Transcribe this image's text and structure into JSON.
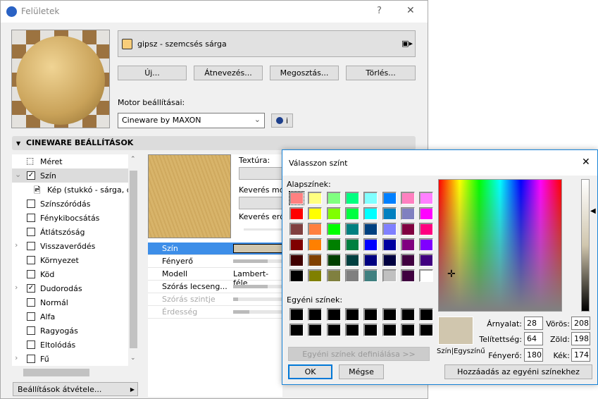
{
  "window": {
    "title": "Felületek",
    "help": "?",
    "close": "✕"
  },
  "material": {
    "name": "gipsz - szemcsés sárga",
    "swatch": "#f8cd7a"
  },
  "buttons": {
    "new": "Új...",
    "rename": "Átnevezés...",
    "share": "Megosztás...",
    "delete": "Törlés..."
  },
  "engine": {
    "label": "Motor beállításai:",
    "value": "Cineware by MAXON",
    "info": "i"
  },
  "section": {
    "title": "CINEWARE BEÁLLÍTÁSOK"
  },
  "tree": [
    {
      "label": "Méret",
      "type": "icon"
    },
    {
      "label": "Szín",
      "checked": true,
      "expandable": true,
      "expanded": true,
      "selected": true
    },
    {
      "label": "Kép (stukkó - sárga, du",
      "type": "image"
    },
    {
      "label": "Színszóródás",
      "checked": false
    },
    {
      "label": "Fénykibocsátás",
      "checked": false
    },
    {
      "label": "Átlátszóság",
      "checked": false
    },
    {
      "label": "Visszaverődés",
      "checked": false,
      "expandable": true
    },
    {
      "label": "Környezet",
      "checked": false
    },
    {
      "label": "Köd",
      "checked": false
    },
    {
      "label": "Dudorodás",
      "checked": true,
      "expandable": true
    },
    {
      "label": "Normál",
      "checked": false
    },
    {
      "label": "Alfa",
      "checked": false
    },
    {
      "label": "Ragyogás",
      "checked": false
    },
    {
      "label": "Eltolódás",
      "checked": false
    },
    {
      "label": "Fű",
      "checked": false,
      "expandable": true
    }
  ],
  "take_settings": "Beállítások átvétele...",
  "texture": {
    "label": "Textúra:",
    "blend_mode": "Keverés mód",
    "blend_strength": "Keverés erős"
  },
  "props": [
    {
      "label": "Szín",
      "selected": true,
      "color": "#d0c6ae"
    },
    {
      "label": "Fényerő",
      "level": 0.7
    },
    {
      "label": "Modell",
      "value": "Lambert-féle"
    },
    {
      "label": "Szórás lecseng...",
      "level": 0.7
    },
    {
      "label": "Szórás szintje",
      "disabled": true,
      "level": 0.1
    },
    {
      "label": "Érdesség",
      "disabled": true,
      "level": 0.33
    }
  ],
  "dialog": {
    "title": "Válasszon színt",
    "close": "✕",
    "basic_label": "Alapszínek:",
    "basic_colors": [
      "#FF8080",
      "#FFFF80",
      "#80FF80",
      "#00FF80",
      "#80FFFF",
      "#0080FF",
      "#FF80C0",
      "#FF80FF",
      "#FF0000",
      "#FFFF00",
      "#80FF00",
      "#00FF40",
      "#00FFFF",
      "#0080C0",
      "#8080C0",
      "#FF00FF",
      "#804040",
      "#FF8040",
      "#00FF00",
      "#008080",
      "#004080",
      "#8080FF",
      "#800040",
      "#FF0080",
      "#800000",
      "#FF8000",
      "#008000",
      "#008040",
      "#0000FF",
      "#0000A0",
      "#800080",
      "#8000FF",
      "#400000",
      "#804000",
      "#004000",
      "#004040",
      "#000080",
      "#000040",
      "#400040",
      "#400080",
      "#000000",
      "#808000",
      "#808040",
      "#808080",
      "#408080",
      "#C0C0C0",
      "#400040",
      "#FFFFFF"
    ],
    "custom_label": "Egyéni színek:",
    "define_custom": "Egyéni színek definiálása >>",
    "ok": "OK",
    "cancel": "Mégse",
    "preview_label": "Szín|Egyszínű",
    "current_color": "#d0c6ae",
    "hue_label": "Árnyalat:",
    "hue": "28",
    "sat_label": "Telítettség:",
    "sat": "64",
    "lum_label": "Fényerő:",
    "lum": "180",
    "red_label": "Vörös:",
    "red": "208",
    "green_label": "Zöld:",
    "green": "198",
    "blue_label": "Kék:",
    "blue": "174",
    "add_custom": "Hozzáadás az egyéni színekhez"
  }
}
